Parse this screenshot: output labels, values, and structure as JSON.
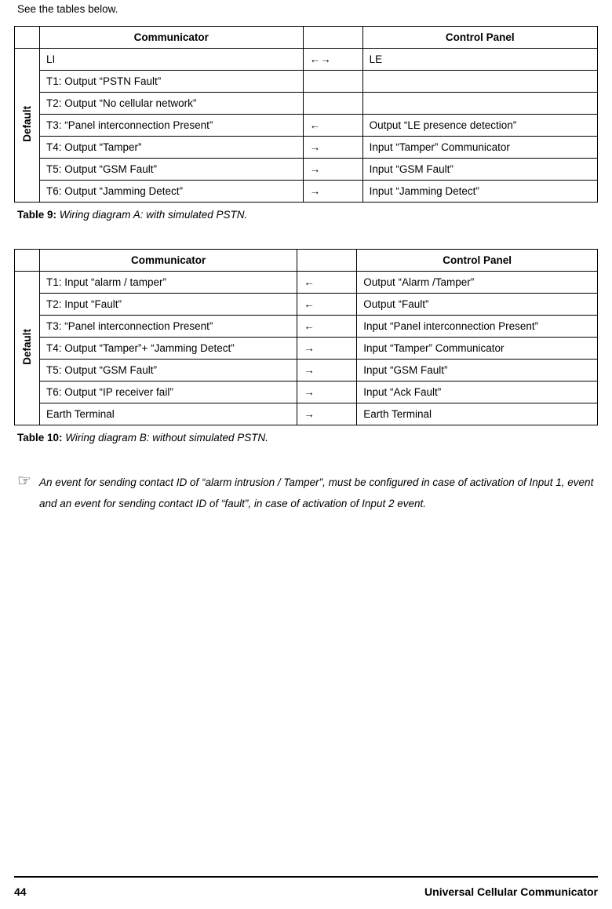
{
  "intro": "See the tables below.",
  "tableA": {
    "side_label": "Default",
    "headers": {
      "col1": "Communicator",
      "col3": "Control Panel"
    },
    "rows": [
      {
        "c1": "LI",
        "dirL": true,
        "dirR": true,
        "c3": "LE"
      },
      {
        "c1": "T1: Output “PSTN Fault”",
        "dirL": false,
        "dirR": false,
        "c3": ""
      },
      {
        "c1": "T2: Output “No cellular network”",
        "dirL": false,
        "dirR": false,
        "c3": ""
      },
      {
        "c1": "T3: “Panel interconnection Present”",
        "dirL": true,
        "dirR": false,
        "c3": "Output “LE presence detection”"
      },
      {
        "c1": "T4: Output “Tamper”",
        "dirL": false,
        "dirR": true,
        "c3": "Input “Tamper” Communicator"
      },
      {
        "c1": "T5: Output “GSM Fault”",
        "dirL": false,
        "dirR": true,
        "c3": "Input “GSM Fault”"
      },
      {
        "c1": "T6: Output “Jamming Detect”",
        "dirL": false,
        "dirR": true,
        "c3": "Input “Jamming Detect”"
      }
    ],
    "caption_label": "Table 9:",
    "caption_text": "Wiring diagram A: with simulated PSTN."
  },
  "tableB": {
    "side_label": "Default",
    "headers": {
      "col1": "Communicator",
      "col3": "Control Panel"
    },
    "rows": [
      {
        "c1": "T1: Input “alarm / tamper”",
        "dirL": true,
        "dirR": false,
        "c3": "Output “Alarm /Tamper”"
      },
      {
        "c1": "T2: Input “Fault”",
        "dirL": true,
        "dirR": false,
        "c3": "Output “Fault”"
      },
      {
        "c1": "T3: “Panel interconnection Present”",
        "dirL": true,
        "dirR": false,
        "c3": "Input “Panel interconnection Present”"
      },
      {
        "c1": "T4: Output “Tamper”+ “Jamming Detect”",
        "dirL": false,
        "dirR": true,
        "c3": "Input “Tamper” Communicator"
      },
      {
        "c1": "T5: Output “GSM Fault”",
        "dirL": false,
        "dirR": true,
        "c3": "Input “GSM Fault”"
      },
      {
        "c1": "T6: Output “IP receiver fail”",
        "dirL": false,
        "dirR": true,
        "c3": "Input “Ack Fault”"
      },
      {
        "c1": "Earth Terminal",
        "dirL": false,
        "dirR": true,
        "c3": "Earth Terminal"
      }
    ],
    "caption_label": "Table 10:",
    "caption_text": "Wiring diagram B: without simulated PSTN."
  },
  "note": "An event for sending contact ID of “alarm intrusion / Tamper”, must be configured in case of activation of Input 1, event and an event for sending contact ID of “fault”, in case of activation of Input 2 event.",
  "footer": {
    "page": "44",
    "title": "Universal Cellular Communicator"
  },
  "arrows": {
    "left": "←",
    "right": "→"
  }
}
